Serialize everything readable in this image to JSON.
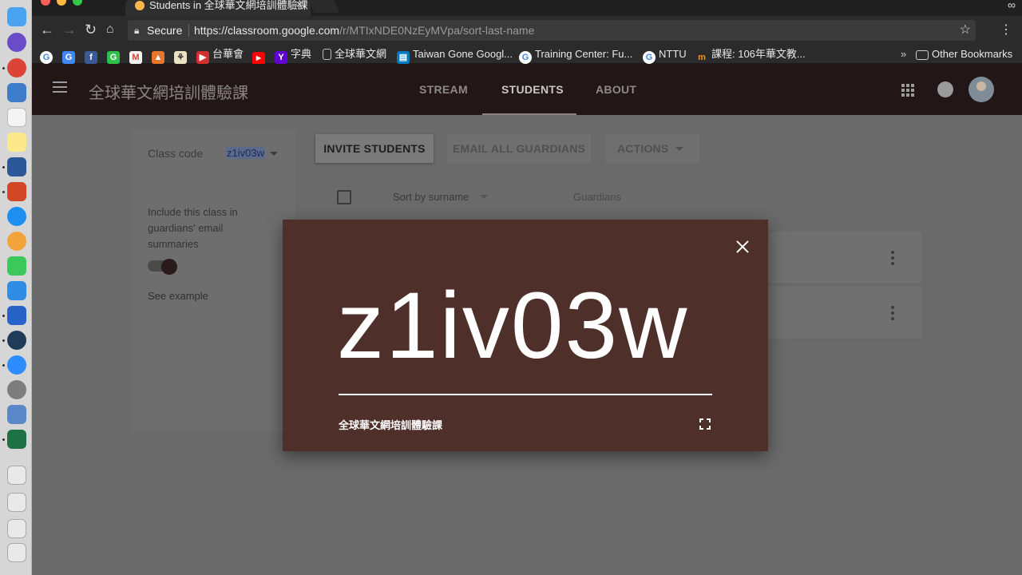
{
  "browser": {
    "tab_title": "Students in 全球華文網培訓體驗課",
    "secure_label": "Secure",
    "url_host": "https://classroom.google.com",
    "url_path": "/r/MTIxNDE0NzEyMVpa/sort-last-name",
    "bookmarks": [
      {
        "label": "",
        "icon": "google-icon"
      },
      {
        "label": "",
        "icon": "google-translate-icon"
      },
      {
        "label": "",
        "icon": "facebook-icon"
      },
      {
        "label": "",
        "icon": "line-icon"
      },
      {
        "label": "",
        "icon": "gmail-icon"
      },
      {
        "label": "",
        "icon": "bookmark-app-icon"
      },
      {
        "label": "",
        "icon": "bookmark-app-icon"
      },
      {
        "label": "台華會",
        "icon": "bookmark-red-icon"
      },
      {
        "label": "",
        "icon": "youtube-icon"
      },
      {
        "label": "字典",
        "icon": "yahoo-icon"
      },
      {
        "label": "全球華文網",
        "icon": "page-icon"
      },
      {
        "label": "Taiwan Gone Googl...",
        "icon": "trello-icon"
      },
      {
        "label": "Training Center: Fu...",
        "icon": "google-icon"
      },
      {
        "label": "NTTU",
        "icon": "google-icon"
      },
      {
        "label": "課程: 106年華文教...",
        "icon": "moodle-icon"
      }
    ],
    "other_bookmarks": "Other Bookmarks"
  },
  "app": {
    "class_name": "全球華文網培訓體驗課",
    "tabs": [
      {
        "label": "STREAM",
        "active": false
      },
      {
        "label": "STUDENTS",
        "active": true
      },
      {
        "label": "ABOUT",
        "active": false
      }
    ]
  },
  "sidebar": {
    "class_code_label": "Class code",
    "class_code": "z1iv03w",
    "include_text": "Include this class in guardians' email summaries",
    "see_example": "See example"
  },
  "actions": {
    "invite": "INVITE STUDENTS",
    "email_guardians": "EMAIL ALL GUARDIANS",
    "actions": "ACTIONS"
  },
  "list": {
    "sort_label": "Sort by surname",
    "guardians_label": "Guardians"
  },
  "modal": {
    "code": "z1iv03w",
    "class_name": "全球華文網培訓體驗課"
  },
  "colors": {
    "modal_bg": "#4e2f2a",
    "header_bg": "#221617"
  }
}
